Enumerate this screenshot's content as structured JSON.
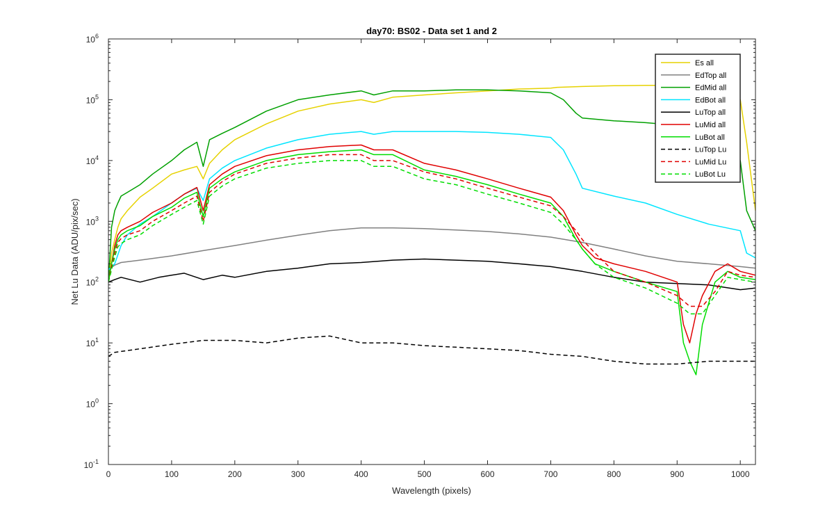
{
  "chart_data": {
    "type": "line",
    "title": "day70: BS02 - Data set 1 and 2",
    "xlabel": "Wavelength (pixels)",
    "ylabel": "Net Lu Data (ADU/pix/sec)",
    "xlim": [
      0,
      1024
    ],
    "ylim": [
      0.1,
      1000000
    ],
    "yscale": "log",
    "grid": false,
    "legend_position": "top-right",
    "xticks": [
      0,
      100,
      200,
      300,
      400,
      500,
      600,
      700,
      800,
      900,
      1000
    ],
    "xtick_labels": [
      "0",
      "100",
      "200",
      "300",
      "400",
      "500",
      "600",
      "700",
      "800",
      "900",
      "1000"
    ],
    "yticks": [
      {
        "value": 0.1,
        "base": "10",
        "exp": "-1"
      },
      {
        "value": 1,
        "base": "10",
        "exp": "0"
      },
      {
        "value": 10,
        "base": "10",
        "exp": "1"
      },
      {
        "value": 100,
        "base": "10",
        "exp": "2"
      },
      {
        "value": 1000,
        "base": "10",
        "exp": "3"
      },
      {
        "value": 10000,
        "base": "10",
        "exp": "4"
      },
      {
        "value": 100000,
        "base": "10",
        "exp": "5"
      },
      {
        "value": 1000000,
        "base": "10",
        "exp": "6"
      }
    ],
    "series": [
      {
        "name": "Es  all",
        "color": "#E6D200",
        "dash": "solid",
        "x": [
          0,
          5,
          10,
          15,
          20,
          30,
          50,
          70,
          100,
          120,
          140,
          150,
          160,
          180,
          200,
          250,
          300,
          350,
          400,
          420,
          450,
          500,
          550,
          600,
          650,
          700,
          710,
          750,
          800,
          850,
          900,
          950,
          1000,
          1010,
          1024
        ],
        "y": [
          100,
          300,
          500,
          800,
          1100,
          1500,
          2500,
          3500,
          6000,
          7000,
          8000,
          5000,
          9000,
          15000,
          22000,
          40000,
          65000,
          85000,
          100000,
          90000,
          110000,
          120000,
          130000,
          140000,
          150000,
          155000,
          160000,
          165000,
          170000,
          172000,
          172000,
          170000,
          100000,
          20000,
          1500
        ]
      },
      {
        "name": "EdTop  all",
        "color": "#808080",
        "dash": "solid",
        "x": [
          0,
          10,
          20,
          50,
          100,
          150,
          200,
          250,
          300,
          350,
          400,
          450,
          500,
          550,
          600,
          650,
          700,
          750,
          800,
          850,
          900,
          950,
          1000,
          1024
        ],
        "y": [
          160,
          190,
          210,
          230,
          270,
          330,
          400,
          490,
          590,
          700,
          780,
          780,
          760,
          720,
          680,
          620,
          550,
          450,
          350,
          270,
          220,
          200,
          180,
          170
        ]
      },
      {
        "name": "EdMid  all",
        "color": "#00A000",
        "dash": "solid",
        "x": [
          0,
          5,
          10,
          15,
          20,
          30,
          50,
          70,
          100,
          120,
          140,
          150,
          160,
          180,
          200,
          250,
          300,
          350,
          400,
          420,
          450,
          500,
          550,
          600,
          650,
          700,
          720,
          740,
          750,
          800,
          850,
          900,
          950,
          1000,
          1010,
          1024
        ],
        "y": [
          100,
          800,
          1500,
          2000,
          2600,
          3000,
          4000,
          6000,
          10000,
          15000,
          20000,
          8000,
          22000,
          28000,
          35000,
          65000,
          100000,
          120000,
          140000,
          120000,
          140000,
          140000,
          145000,
          145000,
          140000,
          130000,
          100000,
          60000,
          50000,
          45000,
          42000,
          38000,
          32000,
          10000,
          1500,
          700
        ]
      },
      {
        "name": "EdBot  all",
        "color": "#00E5FF",
        "dash": "solid",
        "x": [
          0,
          10,
          20,
          30,
          50,
          70,
          100,
          120,
          140,
          150,
          160,
          180,
          200,
          250,
          300,
          350,
          400,
          420,
          450,
          500,
          550,
          600,
          650,
          700,
          720,
          740,
          750,
          800,
          850,
          900,
          950,
          1000,
          1010,
          1024
        ],
        "y": [
          160,
          200,
          400,
          600,
          900,
          1200,
          2000,
          2800,
          3500,
          2200,
          5000,
          7500,
          10000,
          16000,
          22000,
          27000,
          30000,
          27000,
          30000,
          30000,
          30000,
          29000,
          27000,
          24000,
          15000,
          6000,
          3500,
          2600,
          2000,
          1300,
          900,
          700,
          300,
          250
        ]
      },
      {
        "name": "LuTop  all",
        "color": "#000000",
        "dash": "solid",
        "x": [
          0,
          10,
          20,
          50,
          80,
          100,
          120,
          150,
          180,
          200,
          250,
          300,
          350,
          400,
          450,
          500,
          550,
          600,
          650,
          700,
          750,
          800,
          850,
          900,
          950,
          1000,
          1024
        ],
        "y": [
          100,
          110,
          120,
          100,
          120,
          130,
          140,
          110,
          130,
          120,
          150,
          170,
          200,
          210,
          230,
          240,
          230,
          220,
          200,
          180,
          150,
          120,
          100,
          95,
          90,
          75,
          80
        ]
      },
      {
        "name": "LuMid  all",
        "color": "#E00000",
        "dash": "solid",
        "x": [
          0,
          5,
          10,
          15,
          20,
          30,
          50,
          70,
          100,
          120,
          140,
          150,
          160,
          180,
          200,
          250,
          300,
          350,
          400,
          420,
          450,
          500,
          550,
          600,
          650,
          700,
          720,
          740,
          750,
          770,
          800,
          850,
          900,
          910,
          920,
          930,
          940,
          960,
          980,
          1000,
          1024
        ],
        "y": [
          100,
          200,
          400,
          600,
          700,
          800,
          1000,
          1400,
          2000,
          2800,
          3600,
          1500,
          4000,
          6000,
          8000,
          12000,
          15000,
          17000,
          18000,
          15000,
          15000,
          9000,
          7000,
          5000,
          3500,
          2500,
          1500,
          600,
          400,
          250,
          200,
          150,
          100,
          20,
          10,
          30,
          60,
          150,
          200,
          150,
          130
        ]
      },
      {
        "name": "LuBot  all",
        "color": "#00DD00",
        "dash": "solid",
        "x": [
          0,
          5,
          10,
          15,
          20,
          30,
          50,
          70,
          100,
          120,
          140,
          150,
          160,
          180,
          200,
          250,
          300,
          350,
          400,
          420,
          450,
          500,
          550,
          600,
          650,
          700,
          720,
          740,
          750,
          770,
          800,
          850,
          900,
          910,
          920,
          930,
          940,
          960,
          980,
          1000,
          1024
        ],
        "y": [
          100,
          200,
          350,
          500,
          600,
          700,
          850,
          1200,
          1700,
          2400,
          3000,
          1200,
          3500,
          5000,
          6500,
          10000,
          12500,
          14000,
          15000,
          12500,
          12500,
          7000,
          5500,
          4000,
          2800,
          2000,
          1200,
          500,
          350,
          200,
          150,
          100,
          70,
          10,
          5,
          3,
          20,
          100,
          150,
          120,
          110
        ]
      },
      {
        "name": "LuTop  Lu",
        "color": "#000000",
        "dash": "dashed",
        "x": [
          0,
          10,
          50,
          100,
          150,
          200,
          250,
          300,
          350,
          400,
          450,
          500,
          550,
          600,
          650,
          700,
          750,
          800,
          850,
          900,
          950,
          1000,
          1024
        ],
        "y": [
          6,
          7,
          8,
          9.5,
          11,
          11,
          10,
          12,
          13,
          10,
          10,
          9,
          8.5,
          8,
          7.5,
          6.5,
          6,
          5,
          4.5,
          4.5,
          5,
          5,
          5
        ]
      },
      {
        "name": "LuMid  Lu",
        "color": "#E00000",
        "dash": "dashed",
        "x": [
          0,
          5,
          10,
          15,
          20,
          30,
          50,
          70,
          100,
          120,
          140,
          150,
          160,
          180,
          200,
          250,
          300,
          350,
          400,
          420,
          450,
          500,
          550,
          600,
          650,
          700,
          720,
          740,
          750,
          770,
          800,
          850,
          900,
          920,
          940,
          960,
          980,
          1000,
          1024
        ],
        "y": [
          100,
          180,
          300,
          450,
          520,
          600,
          700,
          1000,
          1500,
          2000,
          2600,
          1000,
          3000,
          4500,
          6000,
          9000,
          11000,
          12500,
          12500,
          10000,
          10000,
          6500,
          5000,
          3500,
          2500,
          1800,
          1200,
          700,
          500,
          300,
          150,
          100,
          60,
          40,
          40,
          70,
          150,
          130,
          120
        ]
      },
      {
        "name": "LuBot  Lu",
        "color": "#00DD00",
        "dash": "dashed",
        "x": [
          0,
          5,
          10,
          15,
          20,
          30,
          50,
          70,
          100,
          120,
          140,
          150,
          160,
          180,
          200,
          250,
          300,
          350,
          400,
          420,
          450,
          500,
          550,
          600,
          650,
          700,
          720,
          740,
          750,
          770,
          800,
          850,
          900,
          920,
          940,
          960,
          980,
          1000,
          1024
        ],
        "y": [
          100,
          160,
          260,
          380,
          430,
          500,
          600,
          850,
          1300,
          1700,
          2200,
          900,
          2600,
          3800,
          5000,
          7500,
          9000,
          10000,
          10000,
          8000,
          8000,
          5000,
          4000,
          2800,
          2000,
          1400,
          900,
          500,
          350,
          200,
          120,
          80,
          45,
          30,
          30,
          60,
          120,
          110,
          100
        ]
      }
    ]
  }
}
